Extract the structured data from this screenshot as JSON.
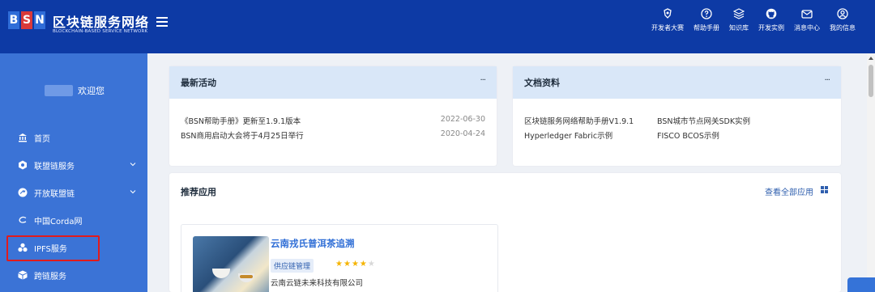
{
  "header": {
    "logo_letters": [
      "B",
      "S",
      "N"
    ],
    "title": "区块链服务网络",
    "subtitle": "BLOCKCHAIN-BASED SERVICE NETWORK",
    "nav": [
      {
        "label": "开发者大赛",
        "icon": "trophy-icon"
      },
      {
        "label": "帮助手册",
        "icon": "help-icon"
      },
      {
        "label": "知识库",
        "icon": "stack-icon"
      },
      {
        "label": "开发实例",
        "icon": "github-icon"
      },
      {
        "label": "消息中心",
        "icon": "mail-icon"
      },
      {
        "label": "我的信息",
        "icon": "user-icon"
      }
    ]
  },
  "sidebar": {
    "welcome": "欢迎您",
    "items": [
      {
        "label": "首页",
        "icon": "home-icon"
      },
      {
        "label": "联盟链服务",
        "icon": "hexagon-icon"
      },
      {
        "label": "开放联盟链",
        "icon": "share-icon"
      },
      {
        "label": "中国Corda网",
        "icon": "corda-icon"
      },
      {
        "label": "IPFS服务",
        "icon": "cluster-icon"
      },
      {
        "label": "跨链服务",
        "icon": "box-icon"
      }
    ]
  },
  "news": {
    "title": "最新活动",
    "more": "···",
    "items": [
      {
        "text": "《BSN帮助手册》更新至1.9.1版本",
        "date": "2022-06-30"
      },
      {
        "text": "BSN商用启动大会将于4月25日举行",
        "date": "2020-04-24"
      }
    ]
  },
  "docs": {
    "title": "文档资料",
    "more": "···",
    "links": [
      "区块链服务网络帮助手册V1.9.1",
      "BSN城市节点网关SDK实例",
      "Hyperledger Fabric示例",
      "FISCO BCOS示例"
    ]
  },
  "recommended": {
    "title": "推荐应用",
    "view_all": "查看全部应用",
    "app": {
      "name": "云南戎氏普洱茶追溯",
      "tag": "供应链管理",
      "rating": 4,
      "rating_max": 5,
      "company": "云南云链未来科技有限公司"
    }
  },
  "colors": {
    "header_bg": "#0d3aa5",
    "sidebar_bg": "#3b73d6",
    "card_head_bg": "#d9e7f8",
    "highlight": "#e21b1b",
    "star": "#f5b400"
  }
}
